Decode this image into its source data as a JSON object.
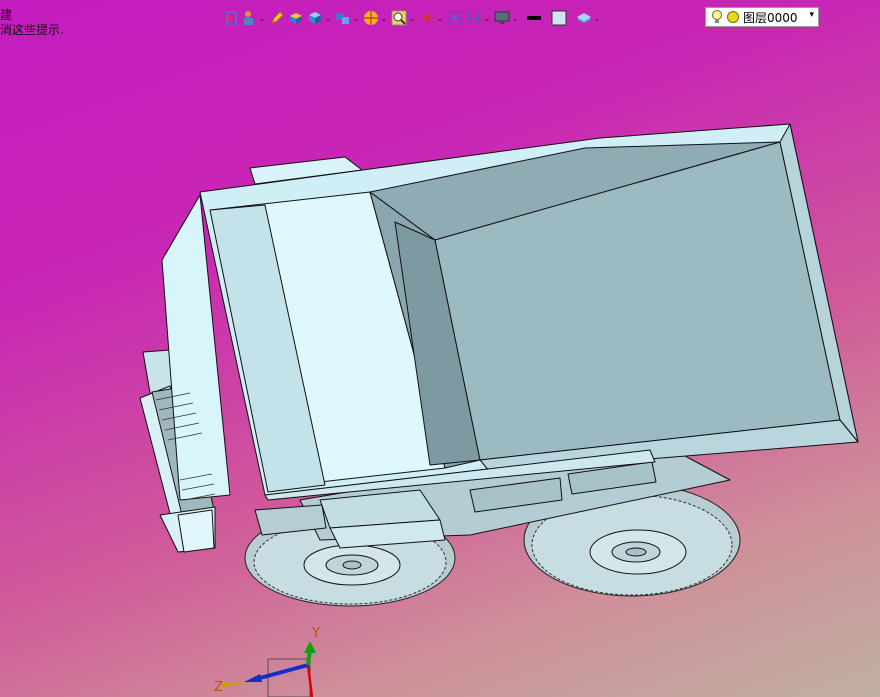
{
  "hint": {
    "line1": "建",
    "line2": "消这些提示."
  },
  "toolbar": {
    "items": [
      {
        "icon": "sketch-icon",
        "dropdown": false
      },
      {
        "icon": "person-component-icon",
        "dropdown": true
      },
      {
        "icon": "pencil-icon",
        "dropdown": false
      },
      {
        "icon": "extrude-box-icon",
        "dropdown": false
      },
      {
        "icon": "solid-cube-icon",
        "dropdown": true
      },
      {
        "icon": "assembly-cubes-icon",
        "dropdown": true
      },
      {
        "icon": "color-wheel-icon",
        "dropdown": true
      },
      {
        "icon": "zoom-fit-icon",
        "dropdown": true
      },
      {
        "icon": "snap-point-icon",
        "dropdown": true
      },
      {
        "icon": "view-orient-icon",
        "dropdown": false
      },
      {
        "icon": "section-view-icon",
        "dropdown": true
      },
      {
        "icon": "display-monitor-icon",
        "dropdown": true
      },
      {
        "icon": "line-color-icon",
        "dropdown": false
      },
      {
        "icon": "fill-color-icon",
        "dropdown": false
      },
      {
        "icon": "layer-manage-icon",
        "dropdown": true
      }
    ],
    "layer_label": "图层0000"
  },
  "triad": {
    "x_label": "Z",
    "y_label": "Y"
  },
  "colors": {
    "background_top": "#c41cc0",
    "background_bottom": "#c0b0a0",
    "model_light": "#d6f3fa",
    "model_mid": "#a8c8d0",
    "model_dark": "#7d9ea6",
    "edge": "#111111"
  }
}
